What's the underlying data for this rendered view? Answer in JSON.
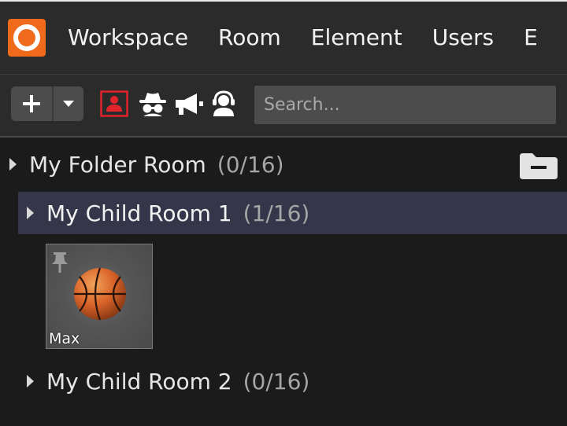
{
  "menubar": {
    "logo": "app-logo",
    "items": [
      "Workspace",
      "Room",
      "Element",
      "Users",
      "E"
    ]
  },
  "toolbar": {
    "add_icon": "plus-icon",
    "dropdown_icon": "caret-down-icon",
    "filters": [
      {
        "icon": "user-icon",
        "active": true,
        "color": "#e0242a"
      },
      {
        "icon": "spy-icon",
        "active": false
      },
      {
        "icon": "megaphone-icon",
        "active": false
      },
      {
        "icon": "support-agent-icon",
        "active": false
      }
    ],
    "search": {
      "placeholder": "Search...",
      "value": ""
    }
  },
  "rooms": [
    {
      "name": "My Folder Room",
      "count": "(0/16)",
      "icon": "folder-minus-icon"
    },
    {
      "name": "My Child Room 1",
      "count": "(1/16)",
      "selected": true,
      "members": [
        {
          "name": "Max",
          "avatar": "basketball-icon",
          "pinned": true
        }
      ]
    },
    {
      "name": "My Child Room 2",
      "count": "(0/16)"
    }
  ],
  "colors": {
    "accent": "#ef6a1a",
    "selected_row": "#36364a"
  }
}
